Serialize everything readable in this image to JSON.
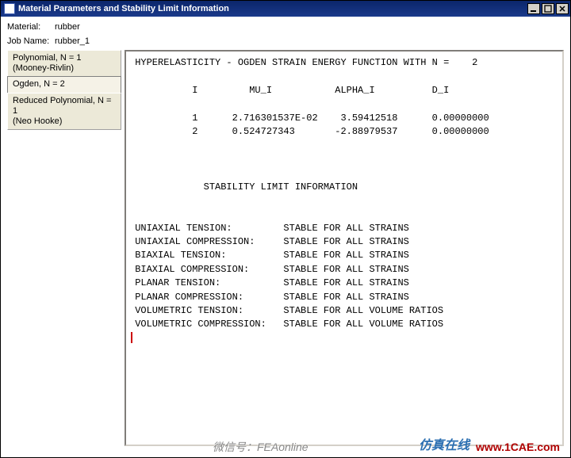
{
  "window": {
    "title": "Material Parameters and Stability Limit Information"
  },
  "info": {
    "material_label": "Material:",
    "material_value": "rubber",
    "jobname_label": "Job Name:",
    "jobname_value": "rubber_1"
  },
  "sidebar": {
    "items": [
      {
        "label": "Polynomial, N = 1",
        "sub": "(Mooney-Rivlin)",
        "selected": false
      },
      {
        "label": "Ogden, N = 2",
        "sub": "",
        "selected": true
      },
      {
        "label": "Reduced Polynomial, N = 1",
        "sub": "(Neo Hooke)",
        "selected": false
      }
    ]
  },
  "report": {
    "heading": " HYPERELASTICITY - OGDEN STRAIN ENERGY FUNCTION WITH N =    2",
    "col_header": "           I         MU_I           ALPHA_I          D_I",
    "rows": [
      "           1      2.716301537E-02    3.59412518      0.00000000",
      "           2      0.524727343       -2.88979537      0.00000000"
    ],
    "stability_title": "             STABILITY LIMIT INFORMATION",
    "stability_lines": [
      " UNIAXIAL TENSION:         STABLE FOR ALL STRAINS",
      " UNIAXIAL COMPRESSION:     STABLE FOR ALL STRAINS",
      " BIAXIAL TENSION:          STABLE FOR ALL STRAINS",
      " BIAXIAL COMPRESSION:      STABLE FOR ALL STRAINS",
      " PLANAR TENSION:           STABLE FOR ALL STRAINS",
      " PLANAR COMPRESSION:       STABLE FOR ALL STRAINS",
      " VOLUMETRIC TENSION:       STABLE FOR ALL VOLUME RATIOS",
      " VOLUMETRIC COMPRESSION:   STABLE FOR ALL VOLUME RATIOS"
    ]
  },
  "watermark": {
    "left": "微信号：FEAonline",
    "right_a": "仿真在线",
    "right_b": "www.1CAE.com"
  },
  "chart_data": {
    "type": "table",
    "title": "HYPERELASTICITY - OGDEN STRAIN ENERGY FUNCTION WITH N = 2",
    "columns": [
      "I",
      "MU_I",
      "ALPHA_I",
      "D_I"
    ],
    "rows": [
      [
        1,
        0.02716301537,
        3.59412518,
        0.0
      ],
      [
        2,
        0.524727343,
        -2.88979537,
        0.0
      ]
    ]
  }
}
